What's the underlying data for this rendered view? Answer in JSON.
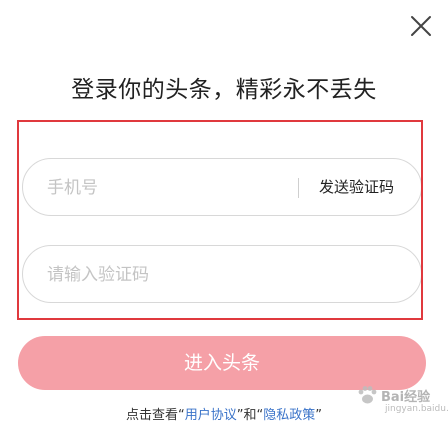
{
  "title": "登录你的头条，精彩永不丢失",
  "phone": {
    "placeholder": "手机号",
    "value": ""
  },
  "send_code_label": "发送验证码",
  "code": {
    "placeholder": "请输入验证码",
    "value": ""
  },
  "enter_button_label": "进入头条",
  "agreement": {
    "prefix": "点击查看",
    "open_quote": "“",
    "user_agreement": "用户协议",
    "close_quote": "”",
    "and": "和",
    "privacy_policy": "隐私政策"
  },
  "watermark": {
    "text": "Bai经验",
    "sub": "jingyan.baidu.com"
  },
  "colors": {
    "highlight_frame": "#e0393e",
    "enter_button": "#f5a0a7",
    "link": "#3a73c9"
  },
  "icons": {
    "close": "close-icon",
    "watermark": "paw-icon"
  }
}
